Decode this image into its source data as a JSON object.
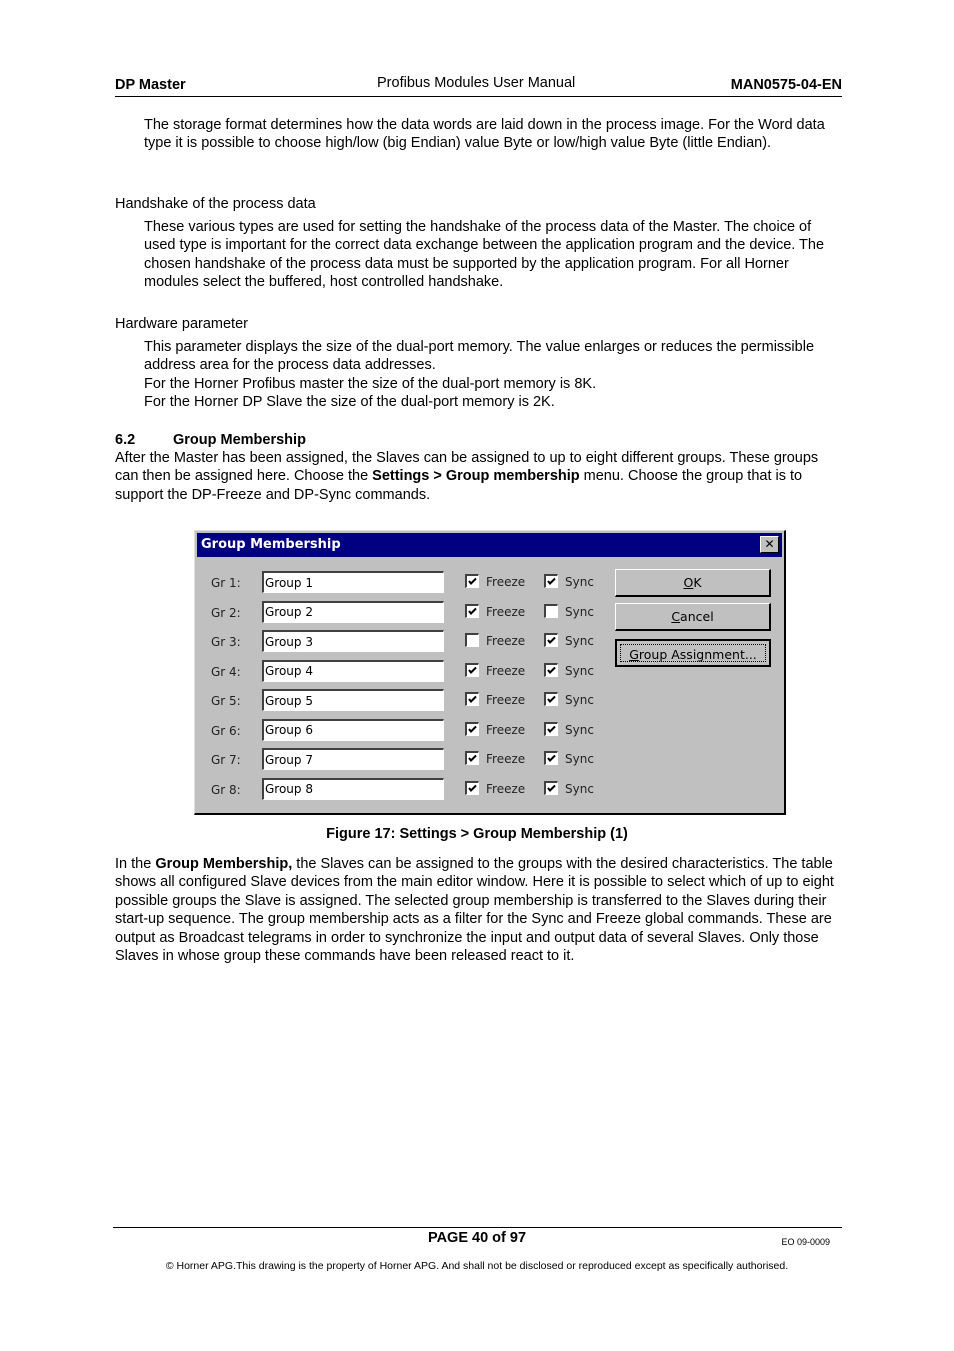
{
  "header": {
    "left": "DP Master",
    "center": "Profibus Modules User Manual",
    "right": "MAN0575-04-EN"
  },
  "body": {
    "storage_para": "The storage format determines how the data words are laid down in the process image.  For the Word data type it is possible to choose high/low (big Endian) value Byte or low/high value Byte (little Endian).",
    "handshake_heading": "Handshake of the process data",
    "handshake_para": "These various types are used for setting the handshake of the process data of the Master.  The choice of used type is important for the correct data exchange between the application program and the device.  The chosen handshake of the process data must be supported by the application program.  For all Horner modules select the buffered, host controlled handshake.",
    "hardware_heading": "Hardware parameter",
    "hardware_para1": "This parameter displays the size of the dual-port memory. The value enlarges or reduces the permissible address area for the process data addresses.",
    "hardware_para2": "For the Horner Profibus master the size of the dual-port memory is 8K.",
    "hardware_para3": "For the Horner DP Slave the size of the dual-port memory is 2K.",
    "section_number": "6.2",
    "section_title": "Group Membership",
    "section_para_a": "After the Master has been assigned, the Slaves can be assigned to up to eight different groups. These groups can then be assigned here.  Choose the ",
    "section_para_bold": "Settings > Group membership",
    "section_para_b": " menu. Choose the group that is to support the DP-Freeze and DP-Sync commands.",
    "figure_caption": "Figure 17: Settings > Group Membership (1)",
    "after_para_a": "In the ",
    "after_para_bold": "Group Membership,",
    "after_para_b": " the Slaves can be assigned to the groups with the desired characteristics. The table shows all configured Slave devices from the main editor window.  Here it is possible to select which of up to eight possible groups the Slave is assigned.  The selected group membership is transferred to the Slaves during their start-up sequence.  The group membership acts as a filter for the Sync and Freeze global commands.  These are output as Broadcast telegrams in order to synchronize the input and output data of several Slaves.  Only those Slaves in whose group these commands have been released react to it."
  },
  "dialog": {
    "title": "Group Membership",
    "close_icon": "close-icon",
    "freeze_label": "Freeze",
    "sync_label": "Sync",
    "groups": [
      {
        "label": "Gr 1:",
        "value": "Group 1",
        "freeze": true,
        "sync": true
      },
      {
        "label": "Gr 2:",
        "value": "Group 2",
        "freeze": true,
        "sync": false
      },
      {
        "label": "Gr 3:",
        "value": "Group 3",
        "freeze": false,
        "sync": true
      },
      {
        "label": "Gr 4:",
        "value": "Group 4",
        "freeze": true,
        "sync": true
      },
      {
        "label": "Gr 5:",
        "value": "Group 5",
        "freeze": true,
        "sync": true
      },
      {
        "label": "Gr 6:",
        "value": "Group 6",
        "freeze": true,
        "sync": true
      },
      {
        "label": "Gr 7:",
        "value": "Group 7",
        "freeze": true,
        "sync": true
      },
      {
        "label": "Gr 8:",
        "value": "Group 8",
        "freeze": true,
        "sync": true
      }
    ],
    "buttons": {
      "ok_mnemonic": "O",
      "ok_rest": "K",
      "cancel_mnemonic": "C",
      "cancel_rest": "ancel",
      "group_assignment_mnemonic": "G",
      "group_assignment_rest": "roup Assignment..."
    }
  },
  "footer": {
    "page": "PAGE 40 of 97",
    "doc_code": "EO 09-0009",
    "copyright": "© Horner APG.This drawing is the property of Horner APG. And shall not be disclosed or reproduced except as specifically authorised."
  }
}
